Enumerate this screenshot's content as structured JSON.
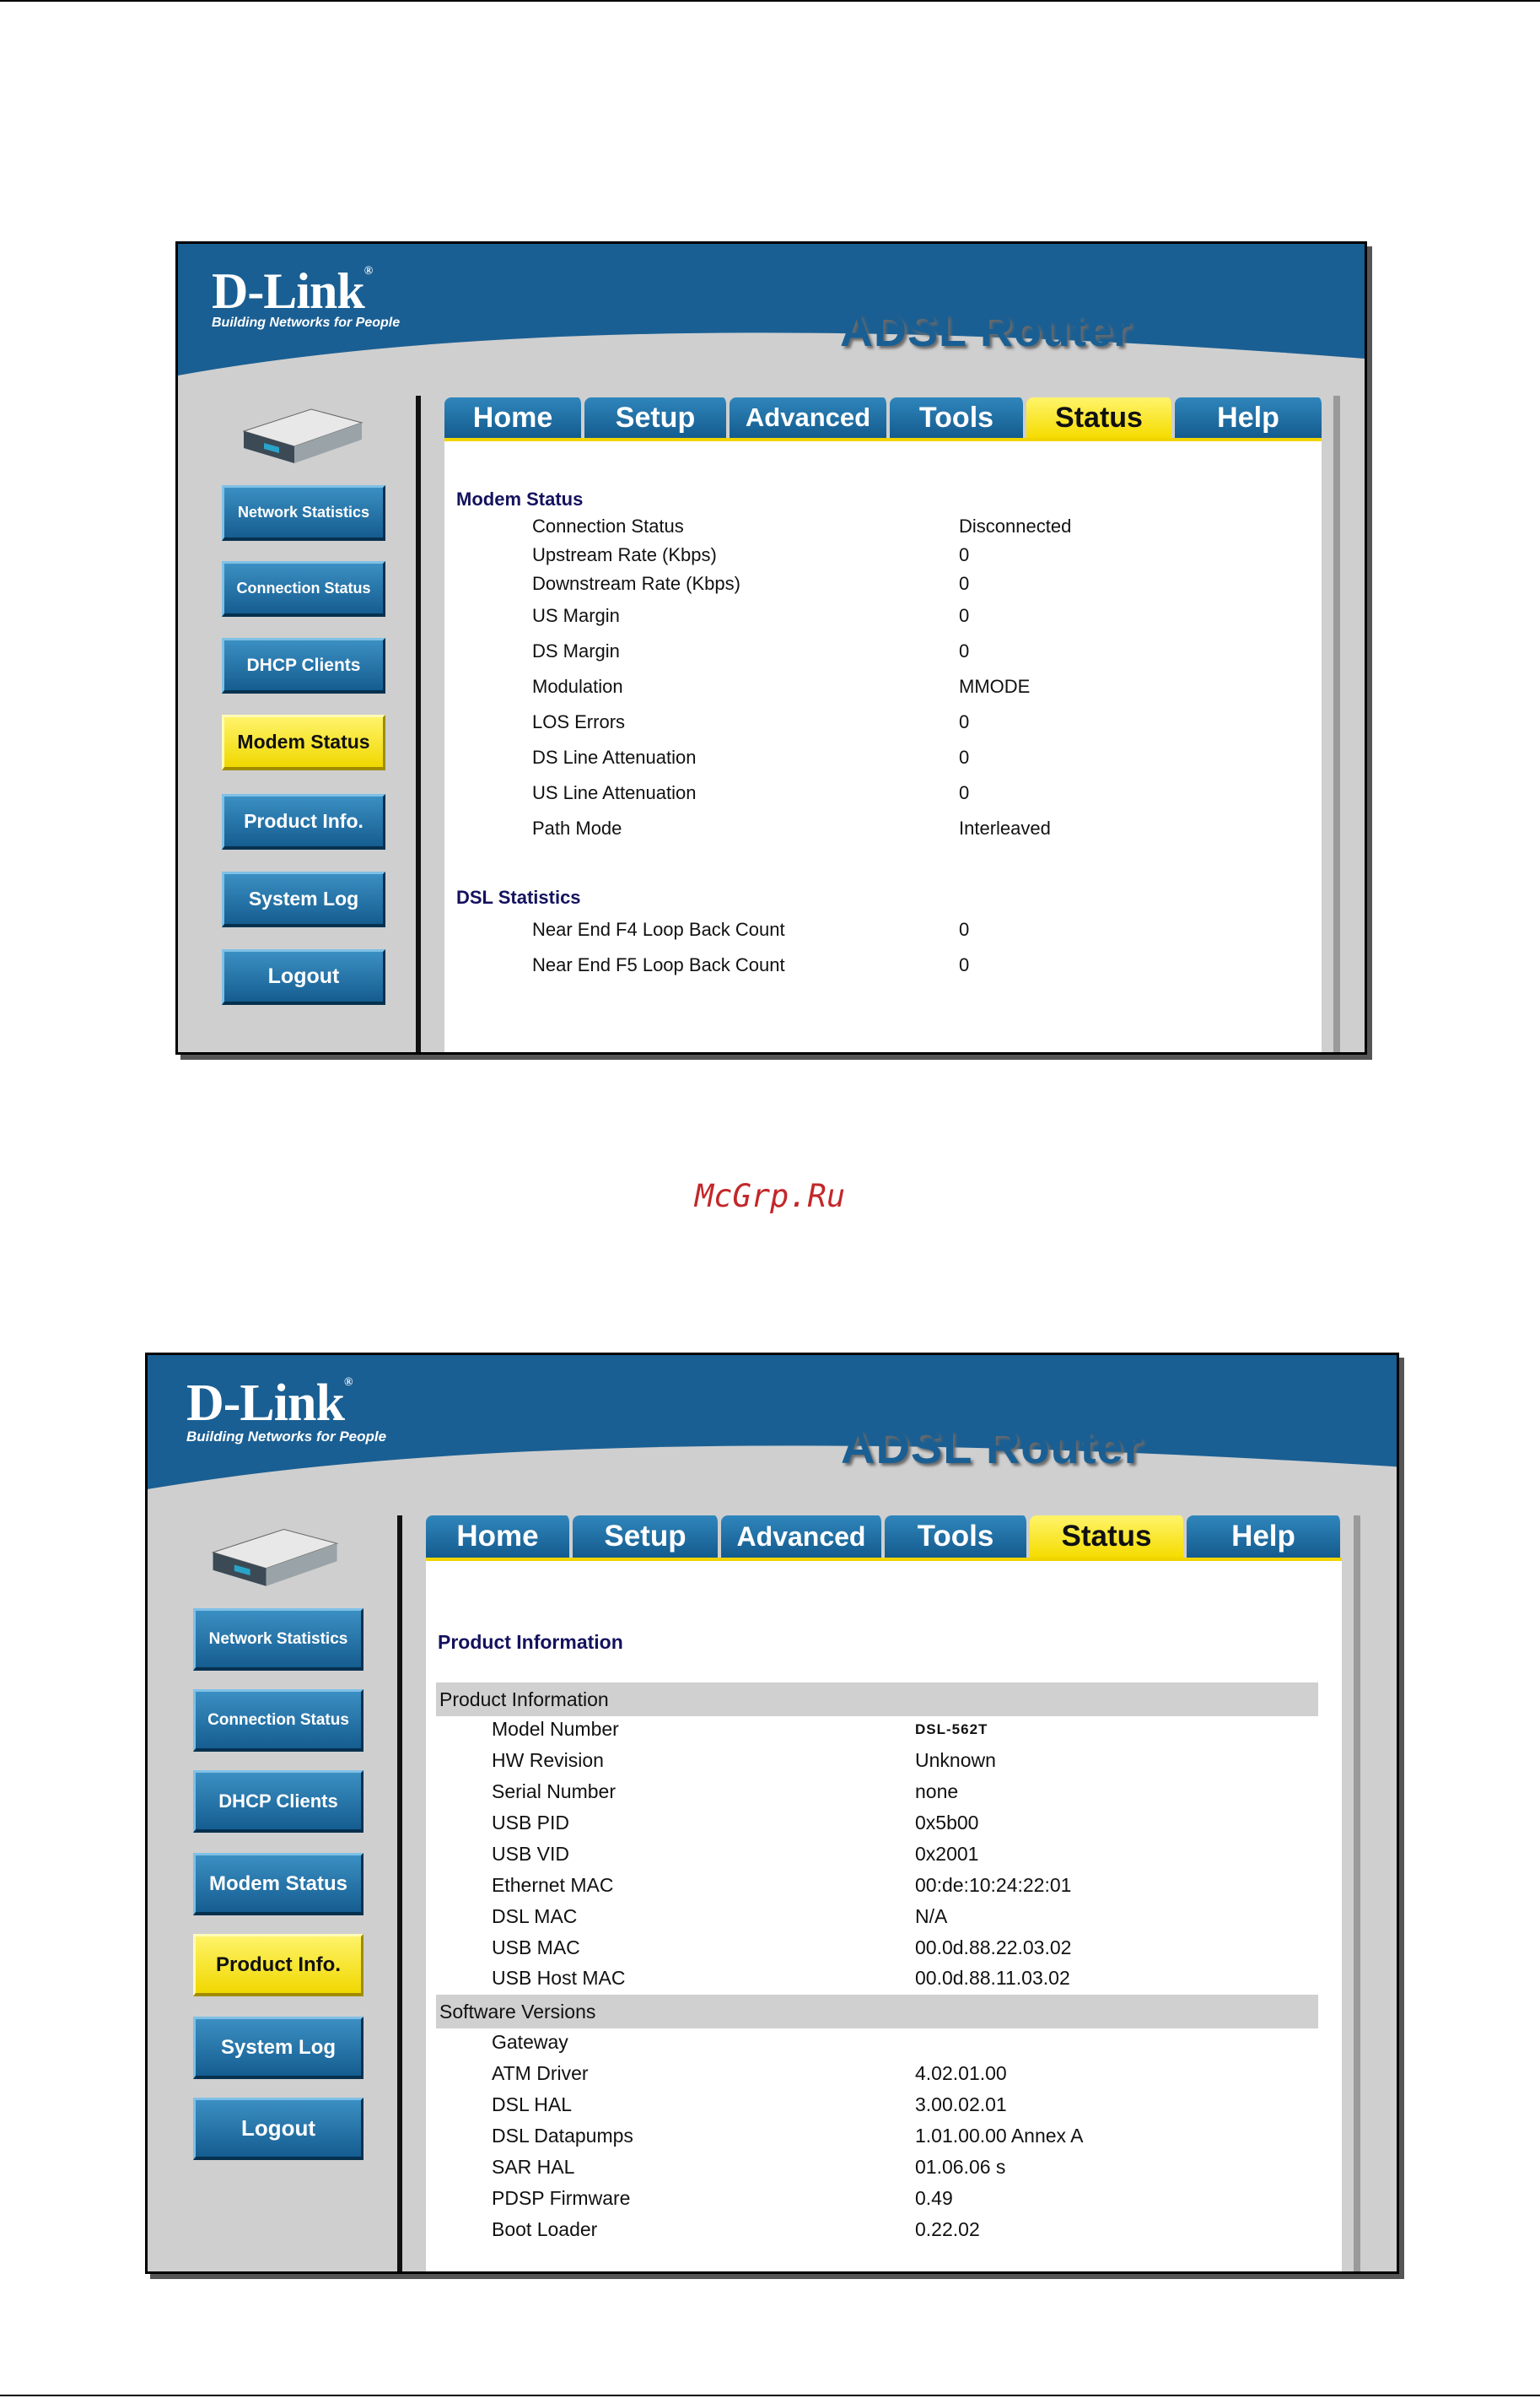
{
  "watermark": "McGrp.Ru",
  "shot1": {
    "logo": {
      "name": "D-Link",
      "reg": "®",
      "tagline": "Building Networks for People"
    },
    "title": "ADSL Router",
    "tabs": [
      "Home",
      "Setup",
      "Advanced",
      "Tools",
      "Status",
      "Help"
    ],
    "active_tab": "Status",
    "sidebar": [
      "Network Statistics",
      "Connection Status",
      "DHCP Clients",
      "Modem Status",
      "Product Info.",
      "System Log",
      "Logout"
    ],
    "active_sidebar": "Modem Status",
    "modem_status": {
      "title": "Modem Status",
      "rows": [
        {
          "label": "Connection Status",
          "value": "Disconnected"
        },
        {
          "label": "Upstream Rate (Kbps)",
          "value": "0"
        },
        {
          "label": "Downstream Rate (Kbps)",
          "value": "0"
        },
        {
          "label": "US Margin",
          "value": "0"
        },
        {
          "label": "DS Margin",
          "value": "0"
        },
        {
          "label": "Modulation",
          "value": "MMODE"
        },
        {
          "label": "LOS Errors",
          "value": "0"
        },
        {
          "label": "DS Line Attenuation",
          "value": "0"
        },
        {
          "label": "US Line Attenuation",
          "value": "0"
        },
        {
          "label": "Path Mode",
          "value": "Interleaved"
        }
      ]
    },
    "dsl_statistics": {
      "title": "DSL Statistics",
      "rows": [
        {
          "label": "Near End F4 Loop Back Count",
          "value": "0"
        },
        {
          "label": "Near End F5 Loop Back Count",
          "value": "0"
        }
      ]
    }
  },
  "shot2": {
    "logo": {
      "name": "D-Link",
      "reg": "®",
      "tagline": "Building Networks for People"
    },
    "title": "ADSL Router",
    "tabs": [
      "Home",
      "Setup",
      "Advanced",
      "Tools",
      "Status",
      "Help"
    ],
    "active_tab": "Status",
    "sidebar": [
      "Network Statistics",
      "Connection Status",
      "DHCP Clients",
      "Modem Status",
      "Product Info.",
      "System Log",
      "Logout"
    ],
    "active_sidebar": "Product Info.",
    "page_title": "Product Information",
    "product_info": {
      "header": "Product Information",
      "rows": [
        {
          "label": "Model Number",
          "value": "DSL-562T"
        },
        {
          "label": "HW Revision",
          "value": "Unknown"
        },
        {
          "label": "Serial Number",
          "value": "none"
        },
        {
          "label": "USB PID",
          "value": "0x5b00"
        },
        {
          "label": "USB VID",
          "value": "0x2001"
        },
        {
          "label": "Ethernet MAC",
          "value": "00:de:10:24:22:01"
        },
        {
          "label": "DSL MAC",
          "value": "N/A"
        },
        {
          "label": "USB MAC",
          "value": "00.0d.88.22.03.02"
        },
        {
          "label": "USB Host MAC",
          "value": "00.0d.88.11.03.02"
        }
      ]
    },
    "software_versions": {
      "header": "Software Versions",
      "rows": [
        {
          "label": "Gateway",
          "value": ""
        },
        {
          "label": "ATM Driver",
          "value": "4.02.01.00"
        },
        {
          "label": "DSL HAL",
          "value": "3.00.02.01"
        },
        {
          "label": "DSL Datapumps",
          "value": "1.01.00.00 Annex A"
        },
        {
          "label": "SAR HAL",
          "value": "01.06.06 s"
        },
        {
          "label": "PDSP Firmware",
          "value": "0.49"
        },
        {
          "label": "Boot Loader",
          "value": "0.22.02"
        }
      ]
    }
  }
}
